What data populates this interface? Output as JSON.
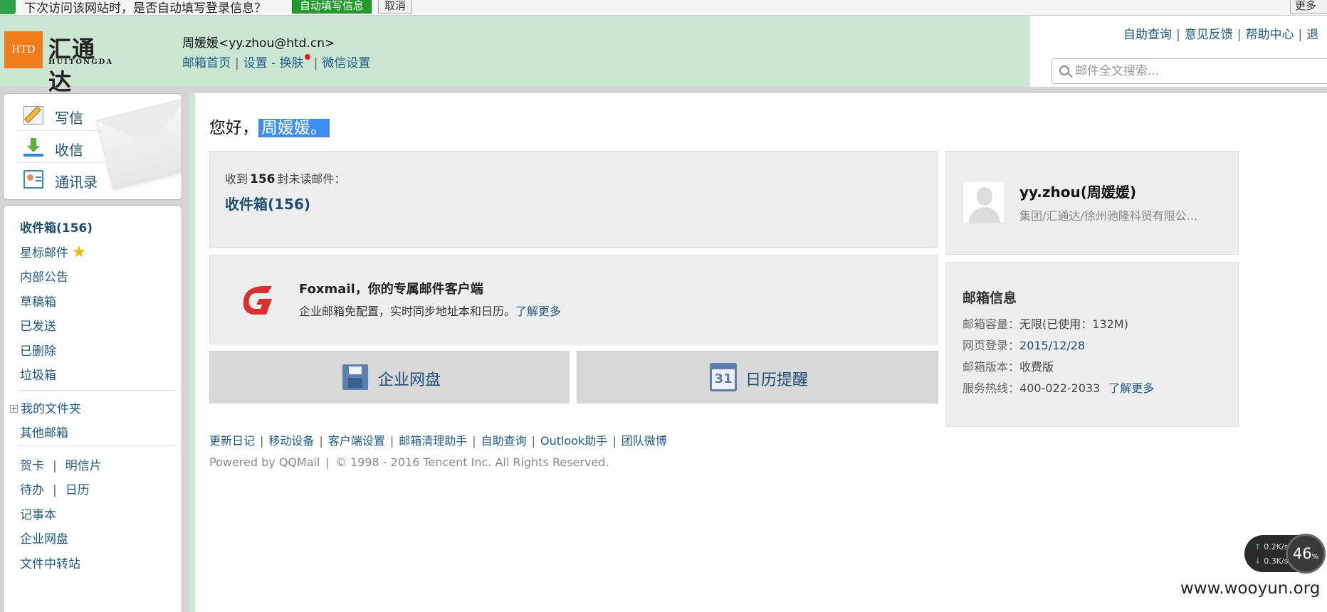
{
  "password_bar": {
    "message": "下次访问该网站时，是否自动填写登录信息？",
    "auto_fill_button": "自动填写信息",
    "cancel_button": "取消",
    "more_button": "更多"
  },
  "header": {
    "logo": {
      "mark": "HTD",
      "name_cn": "汇通达",
      "name_en": "HUITONGDA"
    },
    "user_display": "周媛媛<yy.zhou@htd.cn>",
    "user_links": [
      "邮箱首页",
      "设置 - 换肤",
      "微信设置"
    ],
    "top_links": [
      "自助查询",
      "意见反馈",
      "帮助中心",
      "退"
    ],
    "search_placeholder": "邮件全文搜索..."
  },
  "quick_actions": [
    {
      "label": "写信",
      "icon": "compose-icon"
    },
    {
      "label": "收信",
      "icon": "inbox-download-icon"
    },
    {
      "label": "通讯录",
      "icon": "contacts-icon"
    }
  ],
  "folders": {
    "inbox": "收件箱(156)",
    "starred": "星标邮件",
    "announcements": "内部公告",
    "drafts": "草稿箱",
    "sent": "已发送",
    "deleted": "已删除",
    "spam": "垃圾箱",
    "my_folders": "我的文件夹",
    "other_mailboxes": "其他邮箱",
    "greeting_card": "贺卡",
    "postcard": "明信片",
    "todo": "待办",
    "calendar": "日历",
    "notebook": "记事本",
    "netdisk": "企业网盘",
    "file_transfer": "文件中转站"
  },
  "main": {
    "greeting_prefix": "您好，",
    "greeting_name": "周媛媛。",
    "unread_prefix": "收到",
    "unread_count": "156",
    "unread_suffix_a": "封",
    "unread_suffix_b": "未读邮件：",
    "inbox_link": "收件箱(156)",
    "foxmail_title": "Foxmail，你的专属邮件客户端",
    "foxmail_desc": "企业邮箱免配置，实时同步地址本和日历。",
    "foxmail_more": "了解更多",
    "netdisk_button": "企业网盘",
    "calendar_button": "日历提醒",
    "calendar_day": "31",
    "footer_links": [
      "更新日记",
      "移动设备",
      "客户端设置",
      "邮箱清理助手",
      "自助查询",
      "Outlook助手",
      "团队微博"
    ],
    "powered_by": "Powered by QQMail",
    "copyright": "© 1998 - 2016 Tencent Inc. All Rights Reserved."
  },
  "profile": {
    "name": "yy.zhou(周媛媛)",
    "org": "集团/汇通达/徐州驰隆科贸有限公..."
  },
  "mailbox_info": {
    "title": "邮箱信息",
    "capacity_label": "邮箱容量：",
    "capacity_value": "无限(已使用：132M)",
    "login_label": "网页登录：",
    "login_value": "2015/12/28",
    "version_label": "邮箱版本：",
    "version_value": "收费版",
    "hotline_label": "服务热线：",
    "hotline_value": "400-022-2033",
    "more": "了解更多"
  },
  "speed_widget": {
    "up": "0.2K/s",
    "down": "0.3K/s",
    "percent": "46",
    "percent_unit": "%"
  },
  "watermark": "www.wooyun.org",
  "colors": {
    "header_green": "#cbe6d1",
    "link_blue": "#1c5a8a",
    "highlight_blue": "#3d8ef4",
    "logo_orange": "#f07c1c"
  }
}
